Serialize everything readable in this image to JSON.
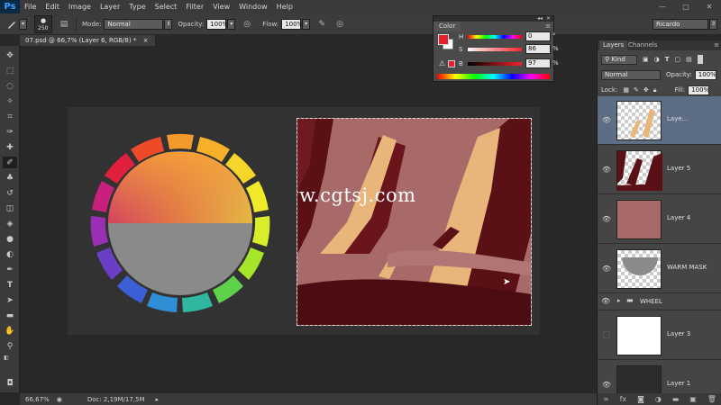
{
  "app": {
    "logo": "Ps"
  },
  "menu": [
    "File",
    "Edit",
    "Image",
    "Layer",
    "Type",
    "Select",
    "Filter",
    "View",
    "Window",
    "Help"
  ],
  "window_controls": [
    "—",
    "▢",
    "✕"
  ],
  "options": {
    "brush_size": "250",
    "mode_label": "Mode:",
    "mode_value": "Normal",
    "opacity_label": "Opacity:",
    "opacity_value": "100%",
    "flow_label": "Flow:",
    "flow_value": "100%",
    "workspace_value": "Ricardo"
  },
  "document": {
    "tab_title": "07.psd @ 66,7% (Layer 6, RGB/8) *",
    "tab_close": "×",
    "watermark": "www.cgtsj.com"
  },
  "status": {
    "zoom": "66,67%",
    "doc_info": "Doc: 2,19M/17,5M"
  },
  "color_panel": {
    "title": "Color",
    "h_label": "H",
    "h_value": "0",
    "h_unit": "°",
    "s_label": "S",
    "s_value": "86",
    "s_unit": "%",
    "b_label": "B",
    "b_value": "97",
    "b_unit": "%"
  },
  "colors": {
    "foreground": "#e5202a",
    "background": "#ffffff",
    "painting_base": "#a86a69",
    "painting_dark": "#5a1015",
    "painting_light": "#e8b57a",
    "selected_layer": "#5d6d83"
  },
  "layers_panel": {
    "tab_layers": "Layers",
    "tab_channels": "Channels",
    "filter_kind": "Kind",
    "blend_mode": "Normal",
    "opacity_label": "Opacity:",
    "opacity_value": "100%",
    "lock_label": "Lock:",
    "fill_label": "Fill:",
    "fill_value": "100%",
    "layers": [
      {
        "name": "Laye...",
        "visible": true,
        "selected": true
      },
      {
        "name": "Layer 5",
        "visible": true,
        "selected": false
      },
      {
        "name": "Layer 4",
        "visible": true,
        "selected": false
      },
      {
        "name": "WARM MASK",
        "visible": true,
        "selected": false
      },
      {
        "name": "WHEEL",
        "visible": true,
        "selected": false,
        "group": true
      },
      {
        "name": "Layer 3",
        "visible": false,
        "selected": false
      },
      {
        "name": "Layer 1",
        "visible": true,
        "selected": false
      }
    ]
  },
  "icons": {
    "eye": "eye-icon",
    "folder": "folder-icon",
    "brush": "brush-icon",
    "airbrush": "airbrush-icon",
    "pressure": "pressure-icon"
  }
}
